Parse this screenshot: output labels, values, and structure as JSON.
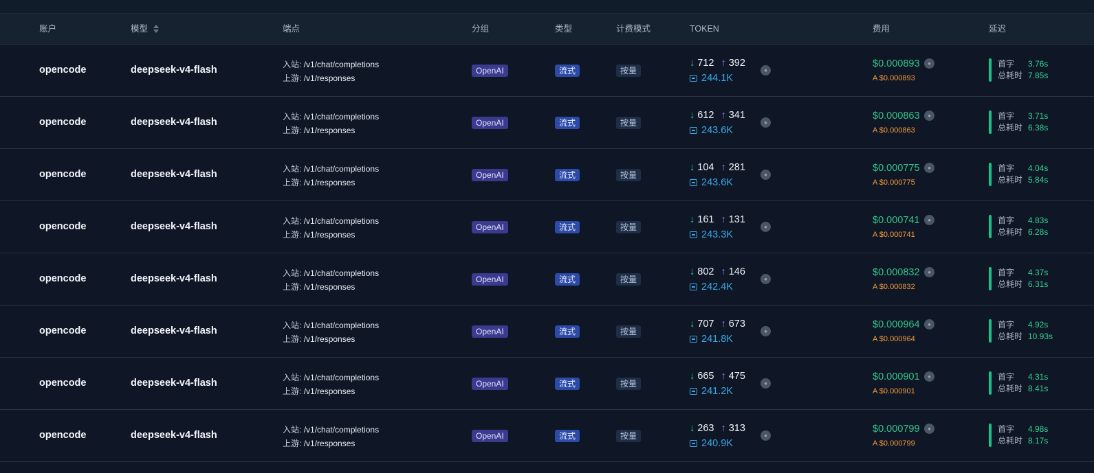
{
  "table": {
    "columns": {
      "account": "账户",
      "model": "模型",
      "endpoint": "端点",
      "group": "分组",
      "type": "类型",
      "billing": "计费模式",
      "token": "TOKEN",
      "cost": "费用",
      "latency": "延迟"
    },
    "labels": {
      "inbound": "入站:",
      "upstream": "上游:",
      "first_token": "首字",
      "total_time": "总耗时"
    },
    "rows": [
      {
        "account": "opencode",
        "model": "deepseek-v4-flash",
        "inbound": "/v1/chat/completions",
        "upstream": "/v1/responses",
        "group": "OpenAI",
        "type": "流式",
        "billing": "按量",
        "tok_in": "712",
        "tok_out": "392",
        "cache": "244.1K",
        "cost": "$0.000893",
        "cost_sub": "A $0.000893",
        "first": "3.76s",
        "total": "7.85s"
      },
      {
        "account": "opencode",
        "model": "deepseek-v4-flash",
        "inbound": "/v1/chat/completions",
        "upstream": "/v1/responses",
        "group": "OpenAI",
        "type": "流式",
        "billing": "按量",
        "tok_in": "612",
        "tok_out": "341",
        "cache": "243.6K",
        "cost": "$0.000863",
        "cost_sub": "A $0.000863",
        "first": "3.71s",
        "total": "6.38s"
      },
      {
        "account": "opencode",
        "model": "deepseek-v4-flash",
        "inbound": "/v1/chat/completions",
        "upstream": "/v1/responses",
        "group": "OpenAI",
        "type": "流式",
        "billing": "按量",
        "tok_in": "104",
        "tok_out": "281",
        "cache": "243.6K",
        "cost": "$0.000775",
        "cost_sub": "A $0.000775",
        "first": "4.04s",
        "total": "5.84s"
      },
      {
        "account": "opencode",
        "model": "deepseek-v4-flash",
        "inbound": "/v1/chat/completions",
        "upstream": "/v1/responses",
        "group": "OpenAI",
        "type": "流式",
        "billing": "按量",
        "tok_in": "161",
        "tok_out": "131",
        "cache": "243.3K",
        "cost": "$0.000741",
        "cost_sub": "A $0.000741",
        "first": "4.83s",
        "total": "6.28s"
      },
      {
        "account": "opencode",
        "model": "deepseek-v4-flash",
        "inbound": "/v1/chat/completions",
        "upstream": "/v1/responses",
        "group": "OpenAI",
        "type": "流式",
        "billing": "按量",
        "tok_in": "802",
        "tok_out": "146",
        "cache": "242.4K",
        "cost": "$0.000832",
        "cost_sub": "A $0.000832",
        "first": "4.37s",
        "total": "6.31s"
      },
      {
        "account": "opencode",
        "model": "deepseek-v4-flash",
        "inbound": "/v1/chat/completions",
        "upstream": "/v1/responses",
        "group": "OpenAI",
        "type": "流式",
        "billing": "按量",
        "tok_in": "707",
        "tok_out": "673",
        "cache": "241.8K",
        "cost": "$0.000964",
        "cost_sub": "A $0.000964",
        "first": "4.92s",
        "total": "10.93s"
      },
      {
        "account": "opencode",
        "model": "deepseek-v4-flash",
        "inbound": "/v1/chat/completions",
        "upstream": "/v1/responses",
        "group": "OpenAI",
        "type": "流式",
        "billing": "按量",
        "tok_in": "665",
        "tok_out": "475",
        "cache": "241.2K",
        "cost": "$0.000901",
        "cost_sub": "A $0.000901",
        "first": "4.31s",
        "total": "8.41s"
      },
      {
        "account": "opencode",
        "model": "deepseek-v4-flash",
        "inbound": "/v1/chat/completions",
        "upstream": "/v1/responses",
        "group": "OpenAI",
        "type": "流式",
        "billing": "按量",
        "tok_in": "263",
        "tok_out": "313",
        "cache": "240.9K",
        "cost": "$0.000799",
        "cost_sub": "A $0.000799",
        "first": "4.98s",
        "total": "8.17s"
      }
    ]
  },
  "icons": {
    "token_in": "arrow-down-icon",
    "token_out": "arrow-up-icon",
    "cache": "cache-icon",
    "info": "info-icon",
    "sort": "sort-icon"
  },
  "colors": {
    "background": "#0f1726",
    "header_bg": "#172231",
    "group_badge": "#3a3a8f",
    "type_badge": "#2d4aa6",
    "billing_badge": "#1f2d47",
    "token_in": "#2fc59a",
    "token_out": "#8f79f5",
    "cache": "#3aa8e6",
    "cost": "#35c48b",
    "cost_sub": "#f59b3c",
    "latency": "#19c28a"
  }
}
